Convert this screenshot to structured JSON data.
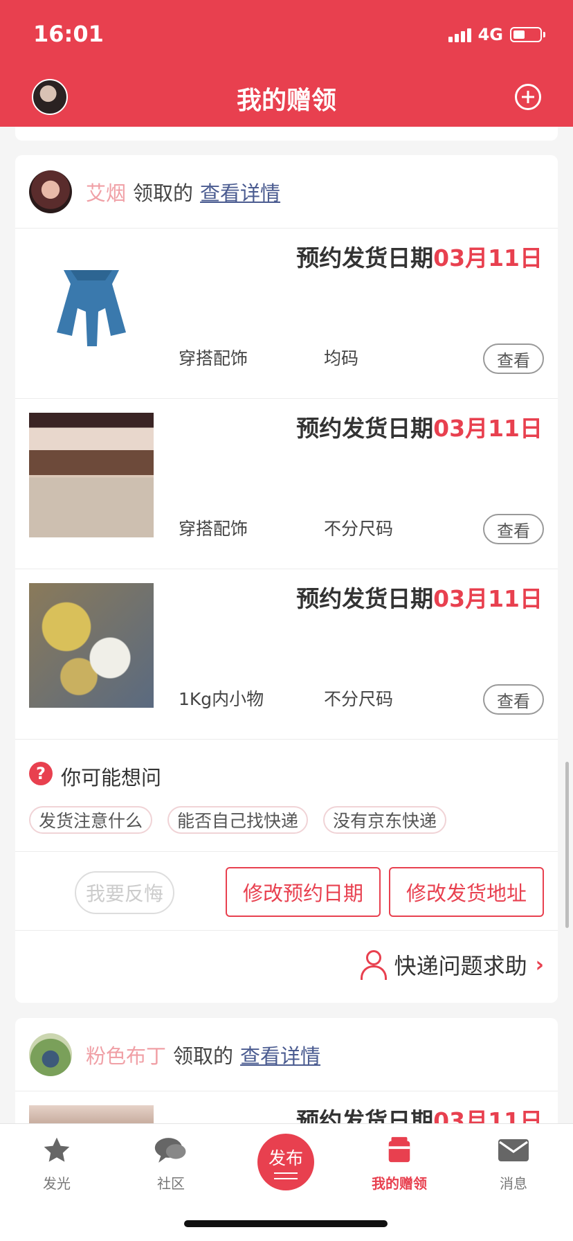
{
  "status_bar": {
    "time": "16:01",
    "network": "4G"
  },
  "header": {
    "title": "我的赠领"
  },
  "claims": [
    {
      "user": "艾烟",
      "claimed_label": "领取的",
      "detail_link": "查看详情",
      "items": [
        {
          "date_prefix": "预约发货日期",
          "date": "03月11日",
          "category": "穿搭配饰",
          "size": "均码",
          "view_label": "查看"
        },
        {
          "date_prefix": "预约发货日期",
          "date": "03月11日",
          "category": "穿搭配饰",
          "size": "不分尺码",
          "view_label": "查看"
        },
        {
          "date_prefix": "预约发货日期",
          "date": "03月11日",
          "category": "1Kg内小物",
          "size": "不分尺码",
          "view_label": "查看"
        }
      ],
      "faq": {
        "title": "你可能想问",
        "chips": [
          "发货注意什么",
          "能否自己找快递",
          "没有京东快递"
        ]
      },
      "actions": {
        "regret": "我要反悔",
        "change_date": "修改预约日期",
        "change_address": "修改发货地址"
      },
      "help": {
        "label": "快递问题求助"
      }
    },
    {
      "user": "粉色布丁",
      "claimed_label": "领取的",
      "detail_link": "查看详情",
      "items": [
        {
          "date_prefix": "预约发货日期",
          "date": "03月11日"
        }
      ]
    }
  ],
  "tabbar": {
    "tabs": [
      {
        "label": "发光",
        "icon": "star-icon"
      },
      {
        "label": "社区",
        "icon": "chat-bubble-icon"
      },
      {
        "label": "发布",
        "icon": "publish-button"
      },
      {
        "label": "我的赠领",
        "icon": "gift-box-icon",
        "active": true
      },
      {
        "label": "消息",
        "icon": "envelope-icon"
      }
    ]
  },
  "colors": {
    "brand": "#e8404f",
    "username": "#f0a0a6",
    "link": "#4a5b90"
  }
}
